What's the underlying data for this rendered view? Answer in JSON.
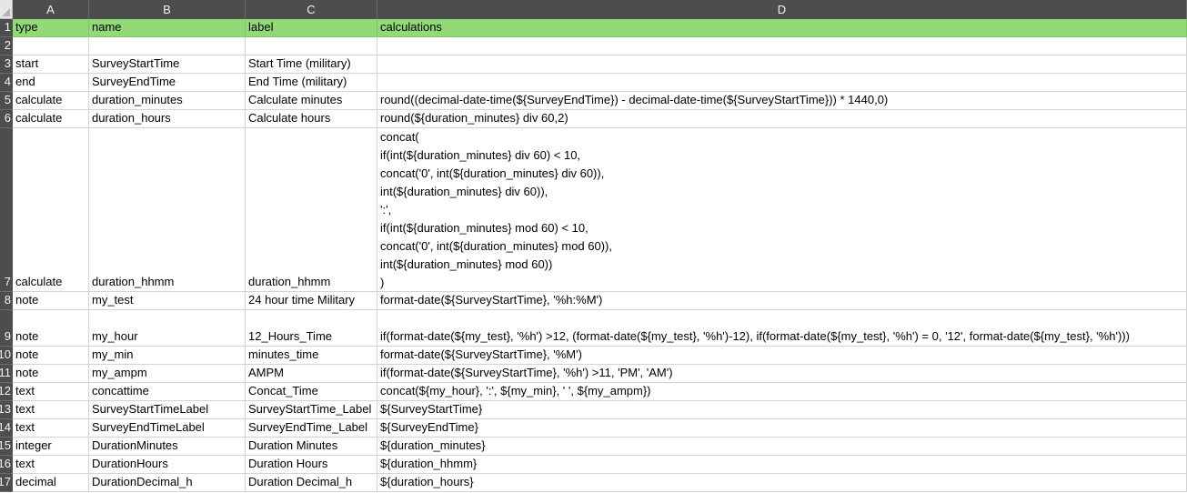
{
  "columns": [
    "A",
    "B",
    "C",
    "D"
  ],
  "rows": [
    {
      "num": "1",
      "cells": [
        "type",
        "name",
        "label",
        "calculations"
      ]
    },
    {
      "num": "2",
      "cells": [
        "",
        "",
        "",
        ""
      ]
    },
    {
      "num": "3",
      "cells": [
        "start",
        "SurveyStartTime",
        "Start Time (military)",
        ""
      ]
    },
    {
      "num": "4",
      "cells": [
        "end",
        "SurveyEndTime",
        "End Time (military)",
        ""
      ]
    },
    {
      "num": "5",
      "cells": [
        "calculate",
        "duration_minutes",
        "Calculate minutes",
        "round((decimal-date-time(${SurveyEndTime}) - decimal-date-time(${SurveyStartTime})) * 1440,0)"
      ]
    },
    {
      "num": "6",
      "cells": [
        "calculate",
        "duration_hours",
        "Calculate hours",
        "round(${duration_minutes} div 60,2)"
      ]
    },
    {
      "num": "7",
      "cells": [
        "calculate",
        "duration_hhmm",
        "duration_hhmm",
        ""
      ],
      "d_lines": [
        "concat(",
        "if(int(${duration_minutes} div 60) < 10,",
        "concat('0', int(${duration_minutes} div 60)),",
        "int(${duration_minutes} div 60)),",
        "':',",
        "if(int(${duration_minutes} mod 60) < 10,",
        "concat('0', int(${duration_minutes} mod 60)),",
        "int(${duration_minutes} mod 60))",
        ")"
      ]
    },
    {
      "num": "8",
      "cells": [
        "note",
        "my_test",
        "24 hour time Military",
        "format-date(${SurveyStartTime}, '%h:%M')"
      ]
    },
    {
      "num": "9",
      "cells": [
        "note",
        "my_hour",
        "12_Hours_Time",
        "if(format-date(${my_test}, '%h') >12, (format-date(${my_test}, '%h')-12), if(format-date(${my_test}, '%h') = 0, '12', format-date(${my_test}, '%h')))"
      ]
    },
    {
      "num": "10",
      "cells": [
        "note",
        "my_min",
        "minutes_time",
        "format-date(${SurveyStartTime}, '%M')"
      ]
    },
    {
      "num": "11",
      "cells": [
        "note",
        "my_ampm",
        "AMPM",
        "if(format-date(${SurveyStartTime}, '%h') >11, 'PM', 'AM')"
      ]
    },
    {
      "num": "12",
      "cells": [
        "text",
        "concattime",
        "Concat_Time",
        "concat(${my_hour}, ':', ${my_min}, ' ', ${my_ampm})"
      ]
    },
    {
      "num": "13",
      "cells": [
        "text",
        "SurveyStartTimeLabel",
        "SurveyStartTime_Label",
        "${SurveyStartTime}"
      ]
    },
    {
      "num": "14",
      "cells": [
        "text",
        "SurveyEndTimeLabel",
        "SurveyEndTime_Label",
        "${SurveyEndTime}"
      ]
    },
    {
      "num": "15",
      "cells": [
        "integer",
        "DurationMinutes",
        "Duration Minutes",
        "${duration_minutes}"
      ]
    },
    {
      "num": "16",
      "cells": [
        "text",
        "DurationHours",
        "Duration Hours",
        "${duration_hhmm}"
      ]
    },
    {
      "num": "17",
      "cells": [
        "decimal",
        "DurationDecimal_h",
        "Duration Decimal_h",
        "${duration_hours}"
      ]
    }
  ],
  "colors": {
    "header_fill": "#92d977",
    "header_bar": "#4d4d4d",
    "gridline": "#d4d4d4"
  }
}
